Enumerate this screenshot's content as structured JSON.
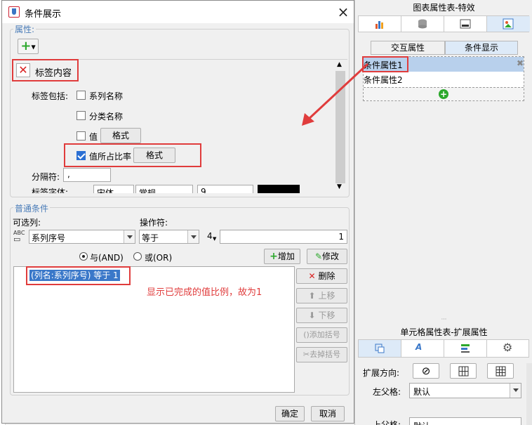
{
  "dialog": {
    "title": "条件展示",
    "close": "×",
    "attributes_legend": "属性:",
    "add_glyph": "+",
    "label_content": "标签内容",
    "label_includes": "标签包括:",
    "options": [
      {
        "label": "系列名称",
        "checked": false
      },
      {
        "label": "分类名称",
        "checked": false
      },
      {
        "label": "值",
        "checked": false,
        "button": "格式"
      },
      {
        "label": "值所占比率",
        "checked": true,
        "button": "格式"
      }
    ],
    "separator_label": "分隔符:",
    "separator_value": ",",
    "font_label": "标签字体:",
    "font_name": "宋体",
    "font_style": "常规",
    "font_size": "9",
    "common_legend": "普通条件",
    "column_label": "可选列:",
    "column_value": "系列序号",
    "operator_label": "操作符:",
    "operator_value": "等于",
    "spinner_value": "4",
    "value_input": "1",
    "and_label": "与(AND)",
    "or_label": "或(OR)",
    "add_button": "增加",
    "modify_button": "修改",
    "condition_item": "(列名:系列序号) 等于 1",
    "annotation": "显示已完成的值比例，故为1",
    "side_buttons": [
      "删除",
      "上移",
      "下移",
      "添加括号",
      "去掉括号"
    ],
    "ok": "确定",
    "cancel": "取消"
  },
  "right_panel": {
    "top_title": "图表属性表-特效",
    "tabs": [
      "交互属性",
      "条件显示"
    ],
    "conditions": [
      "条件属性1",
      "条件属性2"
    ],
    "bottom_title": "单元格属性表-扩展属性",
    "expand_label": "扩展方向:",
    "left_parent_label": "左父格:",
    "left_parent_value": "默认",
    "up_parent_label": "上父格:",
    "up_parent_value": "默认"
  },
  "colors": {
    "accent": "#4a7cb8",
    "red": "#e03c3c",
    "selected": "#b8d0ec",
    "green": "#2ca82c"
  }
}
